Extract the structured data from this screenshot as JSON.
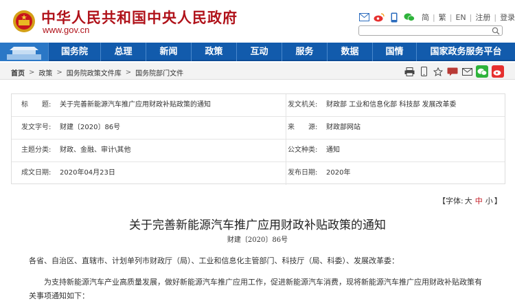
{
  "header": {
    "site_title": "中华人民共和国中央人民政府",
    "site_url": "www.gov.cn",
    "links": [
      "简",
      "繁",
      "EN",
      "注册",
      "登录"
    ],
    "brand_color": "#b0121a"
  },
  "nav": {
    "items": [
      "国务院",
      "总理",
      "新闻",
      "政策",
      "互动",
      "服务",
      "数据",
      "国情",
      "国家政务服务平台"
    ],
    "bg_color": "#125bac"
  },
  "breadcrumb": [
    "首页",
    "政策",
    "国务院政策文件库",
    "国务院部门文件"
  ],
  "info": {
    "rows": [
      {
        "l_label": "标　　题:",
        "l_value": "关于完善新能源汽车推广应用财政补贴政策的通知",
        "r_label": "发文机关:",
        "r_value": "财政部 工业和信息化部 科技部 发展改革委"
      },
      {
        "l_label": "发文字号:",
        "l_value": "财建〔2020〕86号",
        "r_label": "来　　源:",
        "r_value": "财政部网站"
      },
      {
        "l_label": "主题分类:",
        "l_value": "财政、金融、审计\\其他",
        "r_label": "公文种类:",
        "r_value": "通知"
      },
      {
        "l_label": "成文日期:",
        "l_value": "2020年04月23日",
        "r_label": "发布日期:",
        "r_value": "2020年"
      }
    ]
  },
  "font_size": {
    "open": "【字体:",
    "large": "大",
    "medium": "中",
    "small": "小",
    "close": "】"
  },
  "article": {
    "title": "关于完善新能源汽车推广应用财政补贴政策的通知",
    "doc_no": "财建〔2020〕86号",
    "salutation": "各省、自治区、直辖市、计划单列市财政厅（局）、工业和信息化主管部门、科技厅（局、科委）、发展改革委：",
    "body_line1": "为支持新能源汽车产业高质量发展，做好新能源汽车推广应用工作，促进新能源汽车消费，现将新能源汽车推广应用财政补贴政策有",
    "body_line2": "关事项通知如下："
  }
}
